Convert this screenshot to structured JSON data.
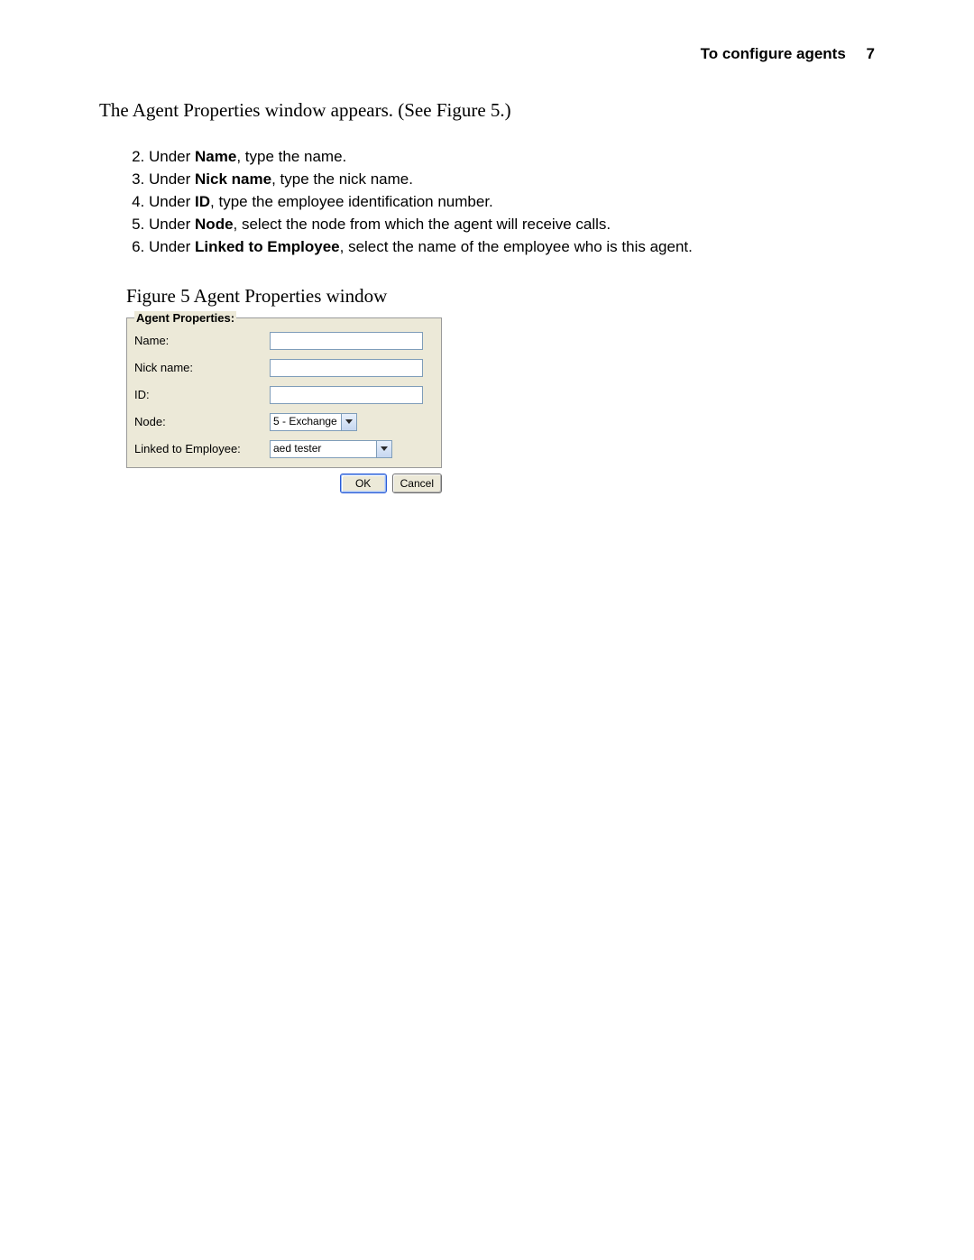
{
  "header": {
    "title": "To configure agents",
    "page": "7"
  },
  "intro": "The Agent Properties window appears. (See Figure 5.)",
  "steps_start": 2,
  "steps": [
    {
      "pre": "Under ",
      "bold": "Name",
      "post": ", type the name."
    },
    {
      "pre": "Under ",
      "bold": "Nick name",
      "post": ", type the nick name."
    },
    {
      "pre": "Under ",
      "bold": "ID",
      "post": ", type the employee identification number."
    },
    {
      "pre": "Under ",
      "bold": "Node",
      "post": ", select the node from which the agent will receive calls."
    },
    {
      "pre": "Under ",
      "bold": "Linked to Employee",
      "post": ", select the name of the employee who is this agent."
    }
  ],
  "figure_caption": "Figure 5   Agent Properties window",
  "agent_panel": {
    "legend": "Agent Properties:",
    "fields": {
      "name_label": "Name:",
      "nick_label": "Nick name:",
      "id_label": "ID:",
      "node_label": "Node:",
      "emp_label": "Linked to Employee:",
      "name_value": "",
      "nick_value": "",
      "id_value": "",
      "node_value": "5 - Exchange",
      "emp_value": "aed tester"
    },
    "buttons": {
      "ok": "OK",
      "cancel": "Cancel"
    }
  }
}
